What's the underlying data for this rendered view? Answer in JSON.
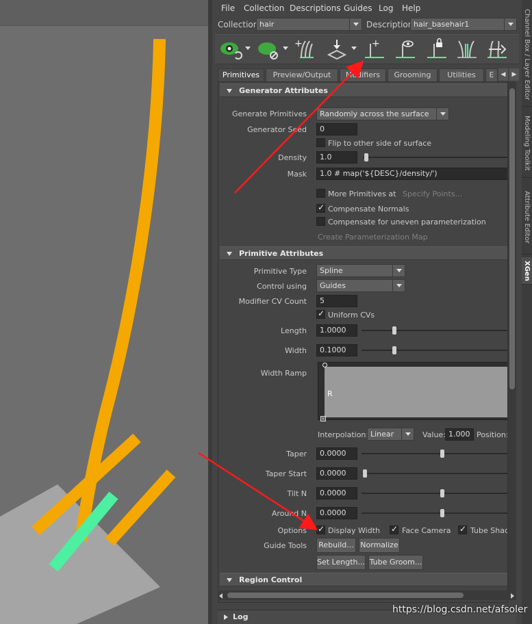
{
  "menu": [
    "File",
    "Collection",
    "Descriptions",
    "Guides",
    "Log",
    "Help"
  ],
  "collection": {
    "label": "Collection",
    "value": "hair"
  },
  "description": {
    "label": "Description",
    "value": "hair_basehair1"
  },
  "toolbar_icons": [
    "eye-icon",
    "eye-off-icon",
    "add-guides-icon",
    "move-guides-icon",
    "add-primitive-icon",
    "show-guides-icon",
    "lock-guides-icon",
    "guide-rebuild-icon",
    "groom-tool-icon"
  ],
  "tabs": [
    "Primitives",
    "Preview/Output",
    "Modifiers",
    "Grooming",
    "Utilities",
    "E"
  ],
  "side_tabs": [
    "Channel Box / Layer Editor",
    "Modeling Toolkit",
    "Attribute Editor",
    "XGen"
  ],
  "generator": {
    "title": "Generator Attributes",
    "generate_primitives_label": "Generate Primitives",
    "generate_primitives_value": "Randomly across the surface",
    "seed_label": "Generator Seed",
    "seed_value": "0",
    "flip_label": "Flip to other side of surface",
    "density_label": "Density",
    "density_value": "1.0",
    "mask_label": "Mask",
    "mask_value": "1.0 # map('${DESC}/density/')",
    "more_primitives_label": "More Primitives at",
    "specify_points_label": "Specify Points...",
    "compensate_normals_label": "Compensate Normals",
    "compensate_uneven_label": "Compensate for uneven parameterization",
    "create_param_map_label": "Create Parameterization Map"
  },
  "primitive": {
    "title": "Primitive Attributes",
    "type_label": "Primitive Type",
    "type_value": "Spline",
    "control_label": "Control using",
    "control_value": "Guides",
    "cv_label": "Modifier CV Count",
    "cv_value": "5",
    "uniform_label": "Uniform CVs",
    "length_label": "Length",
    "length_value": "1.0000",
    "width_label": "Width",
    "width_value": "0.1000",
    "ramp_label": "Width Ramp",
    "ramp_r": "R",
    "interp_label": "Interpolation:",
    "interp_value": "Linear",
    "value_label": "Value:",
    "value_value": "1.000",
    "position_label": "Position:",
    "taper_label": "Taper",
    "taper_value": "0.0000",
    "taper_start_label": "Taper Start",
    "taper_start_value": "0.0000",
    "tilt_label": "Tilt N",
    "tilt_value": "0.0000",
    "around_label": "Around N",
    "around_value": "0.0000",
    "options_label": "Options",
    "display_width_label": "Display Width",
    "face_camera_label": "Face Camera",
    "tube_shade_label": "Tube Shade",
    "guide_tools_label": "Guide Tools",
    "rebuild_label": "Rebuild...",
    "normalize_label": "Normalize",
    "set_length_label": "Set Length...",
    "tube_groom_label": "Tube Groom..."
  },
  "region": {
    "title": "Region Control"
  },
  "log": {
    "title": "Log"
  },
  "watermark": "https://blog.csdn.net/afsoler",
  "colors": {
    "hair": "#f5a800",
    "guide": "#4cf0a0",
    "arrow": "#ff1a1a",
    "panel": "#444444"
  }
}
